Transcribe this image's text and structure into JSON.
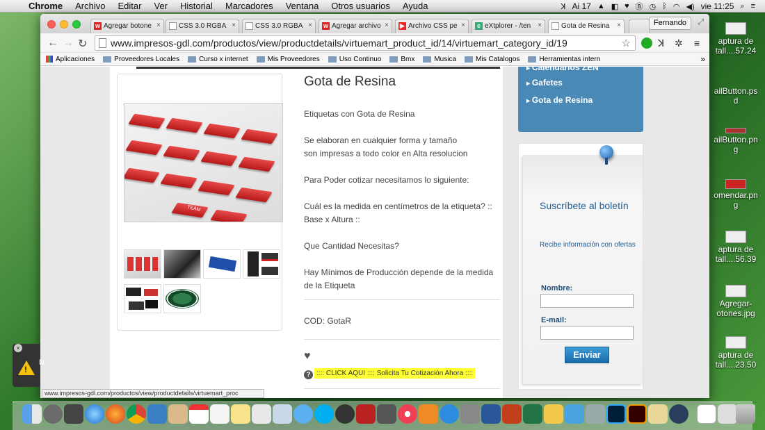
{
  "menubar": {
    "app": "Chrome",
    "items": [
      "Archivo",
      "Editar",
      "Ver",
      "Historial",
      "Marcadores",
      "Ventana",
      "Otros usuarios",
      "Ayuda"
    ],
    "status": {
      "adobe_count": "17",
      "clock": "vie 11:25"
    }
  },
  "desktop": {
    "icons": [
      "aptura de\ntall....57.24",
      "ailButton.ps\nd",
      "ailButton.pn\ng",
      "omendar.pn\ng",
      "aptura de\ntall....56.39",
      "Agregar-\notones.jpg",
      "aptura de\ntall....23.50"
    ]
  },
  "browser": {
    "profile": "Fernando",
    "tabs": [
      {
        "title": "Agregar botone",
        "icon": "w-icon",
        "color": "#d22"
      },
      {
        "title": "CSS 3.0 RGBA |",
        "icon": "page-icon",
        "color": "#ddd"
      },
      {
        "title": "CSS 3.0 RGBA |",
        "icon": "page-icon",
        "color": "#ddd"
      },
      {
        "title": "Agregar archivo",
        "icon": "w-icon",
        "color": "#d22"
      },
      {
        "title": "Archivo CSS pe",
        "icon": "youtube-icon",
        "color": "#e22"
      },
      {
        "title": "eXtplorer - /ten",
        "icon": "extplorer-icon",
        "color": "#3a7"
      },
      {
        "title": "Gota de Resina",
        "icon": "page-icon",
        "color": "#ddd",
        "active": true
      }
    ],
    "url": "www.impresos-gdl.com/productos/view/productdetails/virtuemart_product_id/14/virtuemart_category_id/19",
    "bookmarks": [
      "Aplicaciones",
      "Proveedores Locales",
      "Curso x internet",
      "Mis Proveedores",
      "Uso Continuo",
      "Bmx",
      "Musica",
      "Mis Catalogos",
      "Herramientas intern"
    ],
    "bookmarks_more": "»",
    "status_url": "www.impresos-gdl.com/productos/view/productdetails/virtuemart_proc"
  },
  "product": {
    "title": "Gota de Resina",
    "lines": [
      "Etiquetas con Gota de Resina",
      "Se elaboran en cualquier forma y tamaño",
      "son impresas a todo color en Alta resolucion",
      "Para Poder cotizar necesitamos lo siguiente:",
      "Cuál es la medida en centímetros de la etiqueta? ::",
      "Base x Altura ::",
      "Que Cantidad Necesitas?",
      "Hay Mínimos de Producción depende de la medida",
      "de la Etiqueta"
    ],
    "code": "COD: GotaR",
    "quote_link": ":::: CLICK AQUI :::: Solicita Tu Cotización Ahora ::::",
    "label_text": "TEAM"
  },
  "sidebar": {
    "categories": [
      "Calendarios ZEN",
      "Gafetes",
      "Gota de Resina"
    ],
    "newsletter": {
      "title": "Suscríbete al boletín",
      "subtitle": "Recibe información con ofertas",
      "name_label": "Nombre:",
      "email_label": "E-mail:",
      "submit": "Enviar"
    }
  },
  "notification": {
    "letter": "N"
  },
  "colors": {
    "accent": "#4a89b5",
    "button": "#1c6aa8",
    "highlight": "#ffff33"
  }
}
